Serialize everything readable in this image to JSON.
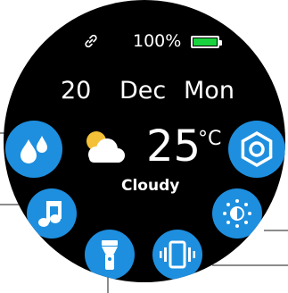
{
  "status": {
    "battery_percent_label": "100%",
    "battery_level": 1.0,
    "link_icon": "link-icon",
    "battery_icon": "battery-icon"
  },
  "date": {
    "day": "20",
    "month": "Dec",
    "weekday": "Mon"
  },
  "weather": {
    "temperature": "25",
    "unit": "°C",
    "condition": "Cloudy",
    "icon": "partly-cloudy-icon"
  },
  "quick_buttons": [
    {
      "name": "water-drops-button",
      "icon": "water-drops-icon"
    },
    {
      "name": "music-button",
      "icon": "music-note-icon"
    },
    {
      "name": "flashlight-button",
      "icon": "flashlight-icon"
    },
    {
      "name": "vibration-button",
      "icon": "vibration-icon"
    },
    {
      "name": "brightness-button",
      "icon": "brightness-icon"
    },
    {
      "name": "settings-button",
      "icon": "hexagon-settings-icon"
    }
  ],
  "colors": {
    "face_background": "#000000",
    "accent_blue": "#1e8fdf",
    "battery_green": "#18d33d",
    "text": "#ffffff"
  }
}
